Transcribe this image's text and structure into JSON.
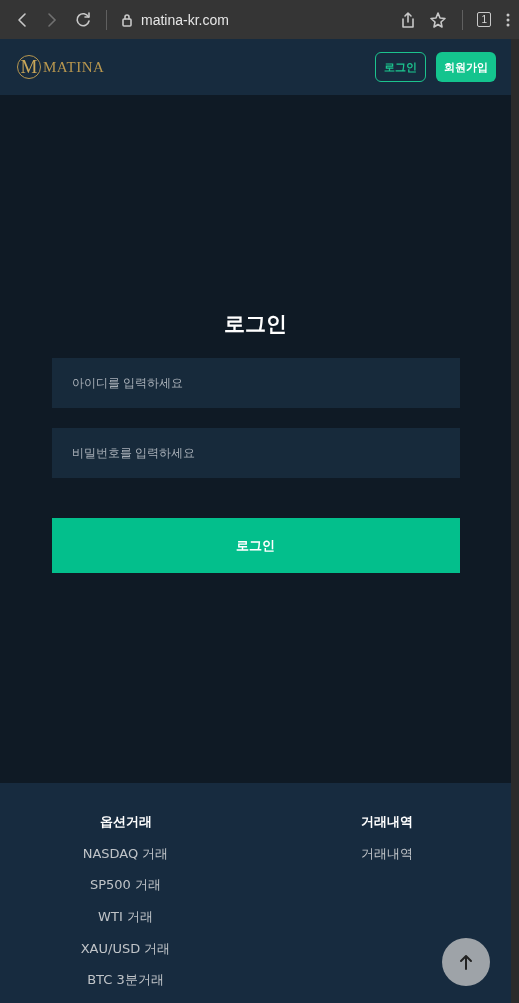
{
  "browser": {
    "url": "matina-kr.com",
    "tab_count": "1"
  },
  "header": {
    "logo_letter": "M",
    "logo_text": "MATINA",
    "buttons": [
      {
        "label": "로그인",
        "kind": "outline"
      },
      {
        "label": "회원가입",
        "kind": "filled"
      }
    ]
  },
  "login": {
    "title": "로그인",
    "fields": [
      {
        "placeholder": "아이디를 입력하세요"
      },
      {
        "placeholder": "비밀번호를 입력하세요"
      }
    ],
    "submit": "로그인"
  },
  "footer": {
    "columns": [
      {
        "heading": "옵션거래",
        "links": [
          "NASDAQ 거래",
          "SP500 거래",
          "WTI 거래",
          "XAU/USD 거래",
          "BTC 3분거래"
        ]
      },
      {
        "heading": "거래내역",
        "links": [
          "거래내역"
        ]
      }
    ]
  }
}
